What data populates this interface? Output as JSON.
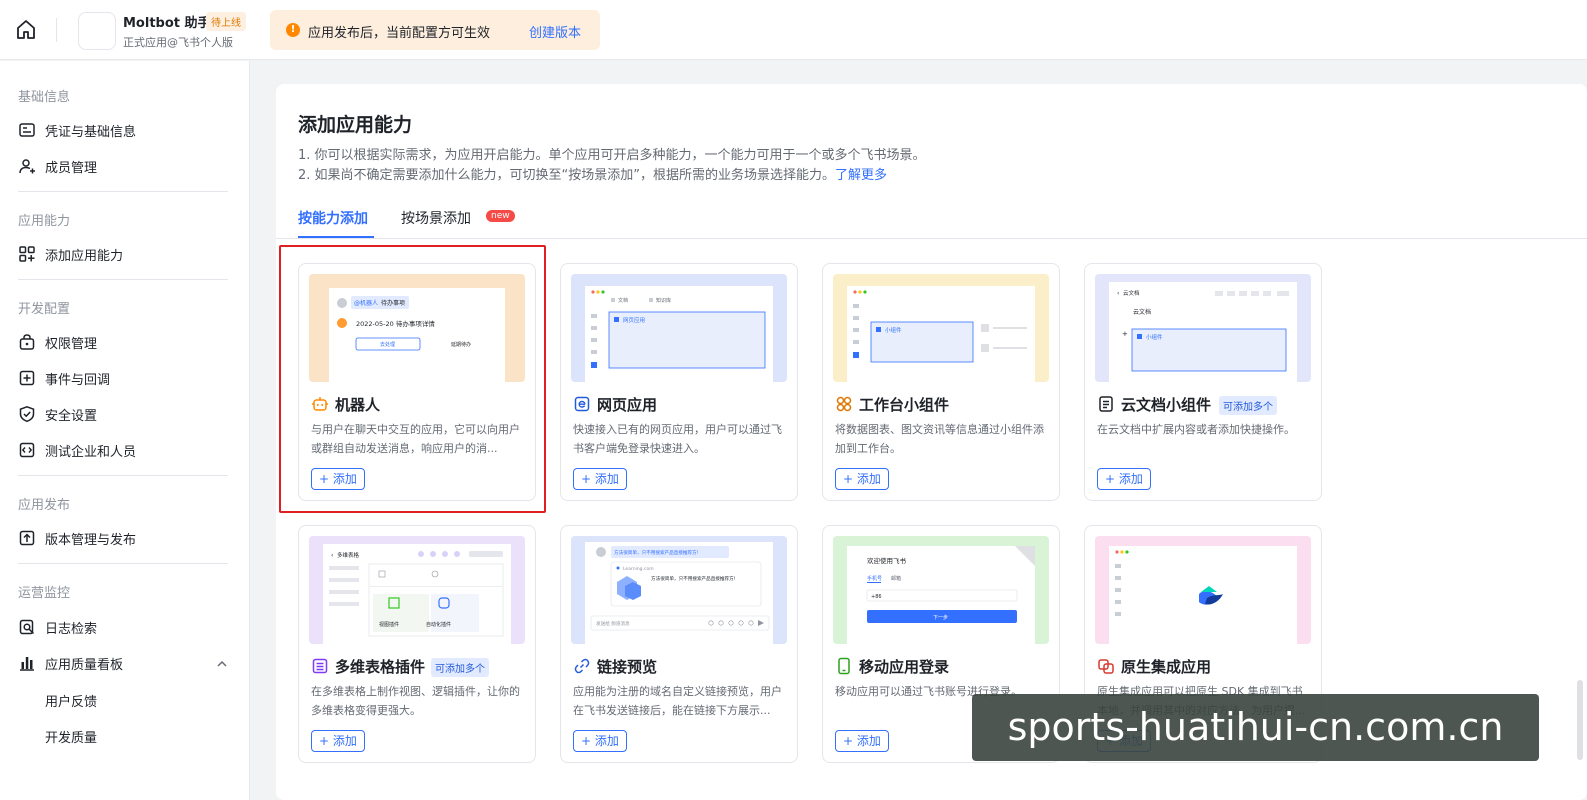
{
  "header": {
    "app_name": "Moltbot 助手",
    "app_status": "待上线",
    "app_sub": "正式应用@飞书个人版",
    "notice_icon": "!",
    "notice_text": "应用发布后，当前配置方可生效",
    "notice_link": "创建版本"
  },
  "sidebar": {
    "sections": [
      {
        "title": "基础信息",
        "items": [
          {
            "label": "凭证与基础信息",
            "icon": "id-card-icon"
          },
          {
            "label": "成员管理",
            "icon": "user-add-icon"
          }
        ]
      },
      {
        "title": "应用能力",
        "items": [
          {
            "label": "添加应用能力",
            "icon": "grid-add-icon"
          }
        ]
      },
      {
        "title": "开发配置",
        "items": [
          {
            "label": "权限管理",
            "icon": "lock-bag-icon"
          },
          {
            "label": "事件与回调",
            "icon": "event-icon"
          },
          {
            "label": "安全设置",
            "icon": "shield-icon"
          },
          {
            "label": "测试企业和人员",
            "icon": "code-icon"
          }
        ]
      },
      {
        "title": "应用发布",
        "items": [
          {
            "label": "版本管理与发布",
            "icon": "upload-icon"
          }
        ]
      },
      {
        "title": "运营监控",
        "items": [
          {
            "label": "日志检索",
            "icon": "search-log-icon"
          },
          {
            "label": "应用质量看板",
            "icon": "bar-chart-icon"
          }
        ]
      }
    ],
    "sub_items": [
      "用户反馈",
      "开发质量"
    ]
  },
  "main": {
    "title": "添加应用能力",
    "desc1": "1. 你可以根据实际需求，为应用开启能力。单个应用可开启多种能力，一个能力可用于一个或多个飞书场景。",
    "desc2": "2. 如果尚不确定需要添加什么能力，可切换至“按场景添加”，根据所需的业务场景选择能力。",
    "desc2_link": "了解更多",
    "tabs": [
      "按能力添加",
      "按场景添加"
    ],
    "new_badge": "new",
    "add_label": "+ 添加",
    "multi_badge": "可添加多个",
    "cards": [
      {
        "title": "机器人",
        "desc": "与用户在聊天中交互的应用，它可以向用户或群组自动发送消息，响应用户的消...",
        "icon": "robot-icon"
      },
      {
        "title": "网页应用",
        "desc": "快速接入已有的网页应用，用户可以通过飞书客户端免登录快速进入。",
        "icon": "web-e-icon"
      },
      {
        "title": "工作台小组件",
        "desc": "将数据图表、图文资讯等信息通过小组件添加到工作台。",
        "icon": "widget-icon"
      },
      {
        "title": "云文档小组件",
        "desc": "在云文档中扩展内容或者添加快捷操作。",
        "icon": "doc-icon"
      },
      {
        "title": "多维表格插件",
        "desc": "在多维表格上制作视图、逻辑插件，让你的多维表格变得更强大。",
        "icon": "table-icon"
      },
      {
        "title": "链接预览",
        "desc": "应用能为注册的域名自定义链接预览，用户在飞书发送链接后，能在链接下方展示...",
        "icon": "link-icon"
      },
      {
        "title": "移动应用登录",
        "desc": "移动应用可以通过飞书账号进行登录。",
        "icon": "mobile-icon"
      },
      {
        "title": "原生集成应用",
        "desc": "原生集成应用可以把原生 SDK 集成到飞书本地，并调用其中的对应方法，为用户提...",
        "icon": "native-icon"
      }
    ],
    "thumbs": {
      "bot_tag": "@机器人",
      "bot_task": "待办事项",
      "bot_date": "2022-05-20 待办事项详情",
      "bot_btn1": "去处理",
      "bot_btn2": "延期待办",
      "web_tab1": "文档",
      "web_tab2": "知识库",
      "web_app": "网页应用",
      "widget_label": "小组件",
      "doc_back": "云文档",
      "doc_title": "云文档",
      "doc_widget": "小组件",
      "base_title": "多维表格",
      "base_view": "视图插件",
      "base_auto": "自动化插件",
      "link_msg": "方法很简单，只不用搜索产品直接推荐方!",
      "link_url": "Learning.com",
      "link_text": "方法很简单，只不用搜索产品直接推荐方!",
      "link_input": "发送给 频道消息",
      "login_title": "欢迎使用飞书",
      "login_tab1": "手机号",
      "login_tab2": "邮箱",
      "login_code": "+86",
      "login_btn": "下一步"
    }
  },
  "watermark": "sports-huatihui-cn.com.cn",
  "colors": {
    "accent": "#3370ff",
    "highlight": "#e02020",
    "status": "#de7802"
  }
}
